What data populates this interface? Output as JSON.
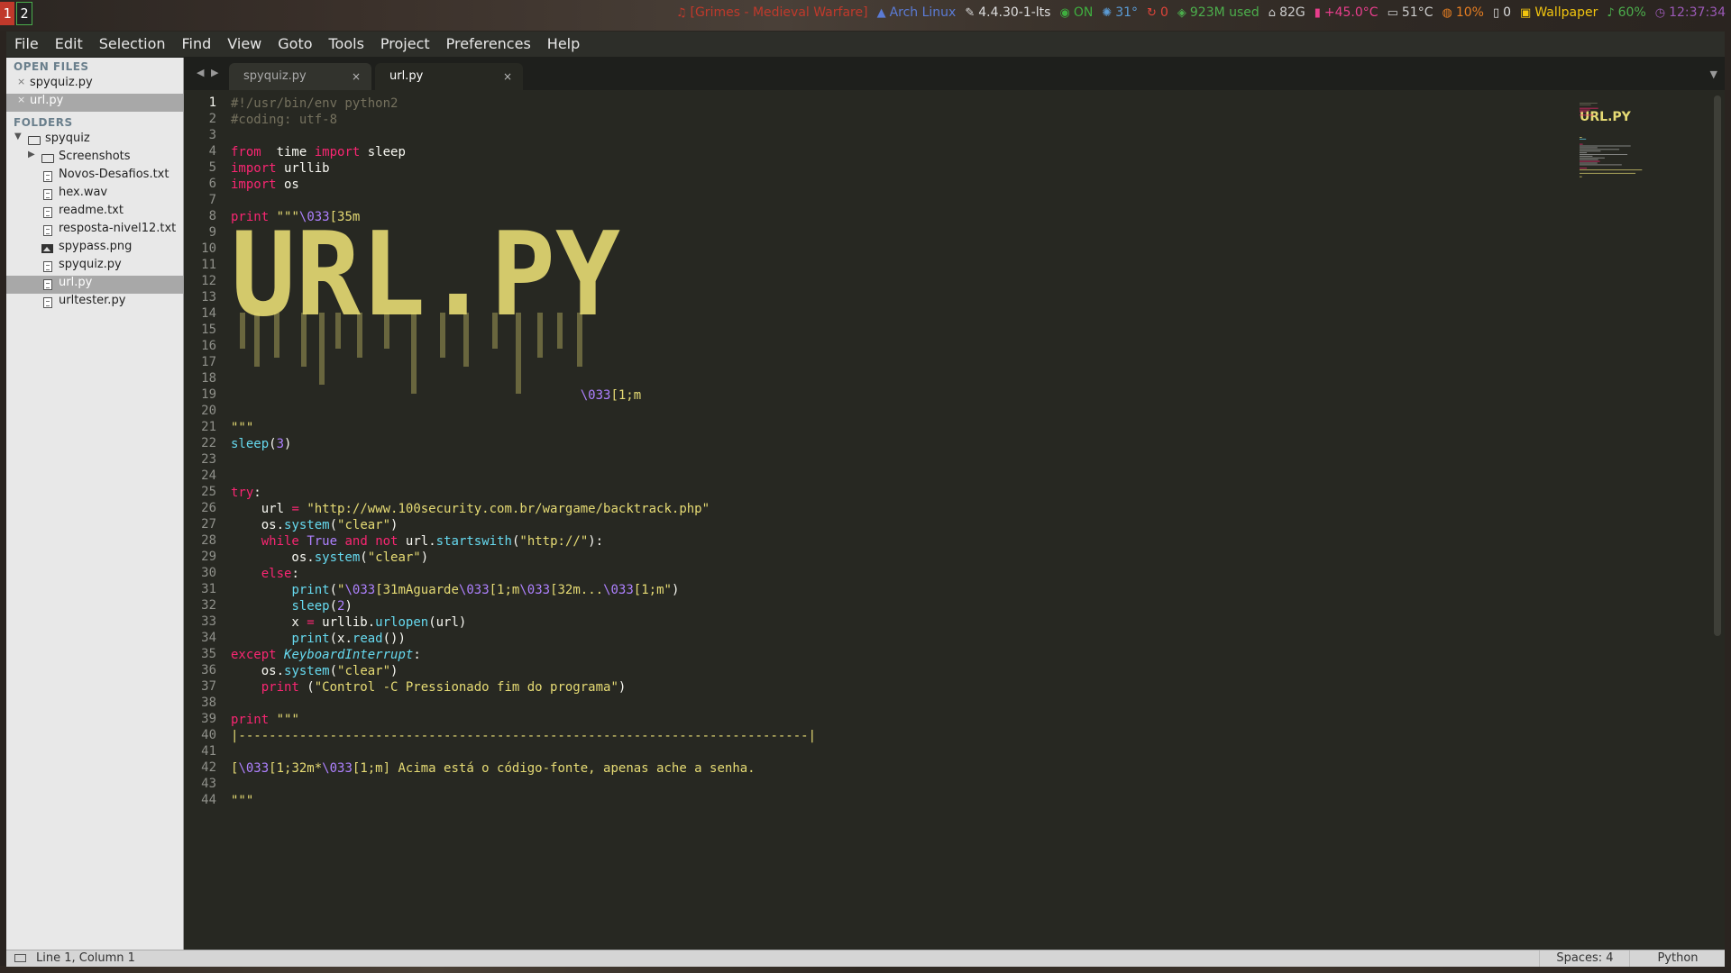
{
  "workspaces": [
    "1",
    "2"
  ],
  "statusbar_top": [
    {
      "icon": "music-icon",
      "text": "[Grimes - Medieval Warfare]",
      "color": "#c0392b"
    },
    {
      "icon": "arch-icon",
      "text": "Arch Linux",
      "color": "#5b7bd5"
    },
    {
      "icon": "wrench-icon",
      "text": "4.4.30-1-lts",
      "color": "#dddddd"
    },
    {
      "icon": "globe-icon",
      "text": "ON",
      "color": "#3fae3f"
    },
    {
      "icon": "gear-icon",
      "text": "31°",
      "color": "#5b9bd5"
    },
    {
      "icon": "refresh-icon",
      "text": "0",
      "color": "#e0443a"
    },
    {
      "icon": "memory-icon",
      "text": "923M used",
      "color": "#4cae4c"
    },
    {
      "icon": "home-icon",
      "text": "82G",
      "color": "#cccccc"
    },
    {
      "icon": "thermometer-icon",
      "text": "+45.0°C",
      "color": "#e83e8c"
    },
    {
      "icon": "monitor-icon",
      "text": "51°C",
      "color": "#cccccc"
    },
    {
      "icon": "cpu-icon",
      "text": "10%",
      "color": "#e67e22"
    },
    {
      "icon": "trash-icon",
      "text": "0",
      "color": "#dddddd"
    },
    {
      "icon": "image-icon",
      "text": "Wallpaper",
      "color": "#f1c40f"
    },
    {
      "icon": "volume-icon",
      "text": "60%",
      "color": "#4cae4c"
    },
    {
      "icon": "clock-icon",
      "text": "12:37:34",
      "color": "#9b59b6"
    }
  ],
  "menu": [
    "File",
    "Edit",
    "Selection",
    "Find",
    "View",
    "Goto",
    "Tools",
    "Project",
    "Preferences",
    "Help"
  ],
  "sidebar": {
    "open_files_header": "OPEN FILES",
    "open_files": [
      {
        "name": "spyquiz.py",
        "selected": false
      },
      {
        "name": "url.py",
        "selected": true
      }
    ],
    "folders_header": "FOLDERS",
    "root": "spyquiz",
    "tree": [
      {
        "name": "Screenshots",
        "type": "folder"
      },
      {
        "name": "Novos-Desafios.txt",
        "type": "file"
      },
      {
        "name": "hex.wav",
        "type": "file"
      },
      {
        "name": "readme.txt",
        "type": "file"
      },
      {
        "name": "resposta-nivel12.txt",
        "type": "file"
      },
      {
        "name": "spypass.png",
        "type": "image"
      },
      {
        "name": "spyquiz.py",
        "type": "file"
      },
      {
        "name": "url.py",
        "type": "file",
        "selected": true
      },
      {
        "name": "urltester.py",
        "type": "file"
      }
    ]
  },
  "tabs": [
    {
      "label": "spyquiz.py",
      "active": false
    },
    {
      "label": "url.py",
      "active": true
    }
  ],
  "code_lines": [
    [
      [
        "cm",
        "#!/usr/bin/env python2"
      ]
    ],
    [
      [
        "cm",
        "#coding: utf-8"
      ]
    ],
    [],
    [
      [
        "kw",
        "from"
      ],
      [
        "",
        "  time "
      ],
      [
        "kw",
        "import"
      ],
      [
        "",
        " sleep"
      ]
    ],
    [
      [
        "kw",
        "import"
      ],
      [
        "",
        " urllib"
      ]
    ],
    [
      [
        "kw",
        "import"
      ],
      [
        "",
        " os"
      ]
    ],
    [],
    [
      [
        "kw",
        "print"
      ],
      [
        "",
        " "
      ],
      [
        "st2",
        "\"\"\""
      ],
      [
        "nm",
        "\\033"
      ],
      [
        "st2",
        "[35m"
      ]
    ],
    [],
    [],
    [],
    [],
    [],
    [],
    [],
    [],
    [],
    [],
    [
      [
        "",
        "                                              "
      ],
      [
        "nm",
        "\\033"
      ],
      [
        "st2",
        "[1;m"
      ]
    ],
    [],
    [
      [
        "st2",
        "\"\"\""
      ]
    ],
    [
      [
        "fn",
        "sleep"
      ],
      [
        "",
        "("
      ],
      [
        "nm",
        "3"
      ],
      [
        "",
        ")"
      ]
    ],
    [],
    [],
    [
      [
        "kw",
        "try"
      ],
      [
        "",
        ":"
      ]
    ],
    [
      [
        "",
        "    url "
      ],
      [
        "kw",
        "="
      ],
      [
        "",
        " "
      ],
      [
        "st2",
        "\"http://www.100security.com.br/wargame/backtrack.php\""
      ]
    ],
    [
      [
        "",
        "    os."
      ],
      [
        "fn",
        "system"
      ],
      [
        "",
        "("
      ],
      [
        "st2",
        "\"clear\""
      ],
      [
        "",
        ")"
      ]
    ],
    [
      [
        "",
        "    "
      ],
      [
        "kw",
        "while"
      ],
      [
        "",
        " "
      ],
      [
        "nm",
        "True"
      ],
      [
        "",
        " "
      ],
      [
        "kw",
        "and"
      ],
      [
        "",
        " "
      ],
      [
        "kw",
        "not"
      ],
      [
        "",
        " url."
      ],
      [
        "fn",
        "startswith"
      ],
      [
        "",
        "("
      ],
      [
        "st2",
        "\"http://\""
      ],
      [
        "",
        "):"
      ]
    ],
    [
      [
        "",
        "        os."
      ],
      [
        "fn",
        "system"
      ],
      [
        "",
        "("
      ],
      [
        "st2",
        "\"clear\""
      ],
      [
        "",
        ")"
      ]
    ],
    [
      [
        "",
        "    "
      ],
      [
        "kw",
        "else"
      ],
      [
        "",
        ":"
      ]
    ],
    [
      [
        "",
        "        "
      ],
      [
        "fn",
        "print"
      ],
      [
        "",
        "("
      ],
      [
        "st2",
        "\""
      ],
      [
        "nm",
        "\\033"
      ],
      [
        "st2",
        "[31mAguarde"
      ],
      [
        "nm",
        "\\033"
      ],
      [
        "st2",
        "[1;m"
      ],
      [
        "nm",
        "\\033"
      ],
      [
        "st2",
        "[32m..."
      ],
      [
        "nm",
        "\\033"
      ],
      [
        "st2",
        "[1;m\""
      ],
      [
        "",
        ")"
      ]
    ],
    [
      [
        "",
        "        "
      ],
      [
        "fn",
        "sleep"
      ],
      [
        "",
        "("
      ],
      [
        "nm",
        "2"
      ],
      [
        "",
        ")"
      ]
    ],
    [
      [
        "",
        "        x "
      ],
      [
        "kw",
        "="
      ],
      [
        "",
        " urllib."
      ],
      [
        "fn",
        "urlopen"
      ],
      [
        "",
        "(url)"
      ]
    ],
    [
      [
        "",
        "        "
      ],
      [
        "fn",
        "print"
      ],
      [
        "",
        "(x."
      ],
      [
        "fn",
        "read"
      ],
      [
        "",
        "())"
      ]
    ],
    [
      [
        "kw",
        "except"
      ],
      [
        "",
        " "
      ],
      [
        "cls",
        "KeyboardInterrupt"
      ],
      [
        "",
        ":"
      ]
    ],
    [
      [
        "",
        "    os."
      ],
      [
        "fn",
        "system"
      ],
      [
        "",
        "("
      ],
      [
        "st2",
        "\"clear\""
      ],
      [
        "",
        ")"
      ]
    ],
    [
      [
        "",
        "    "
      ],
      [
        "kw",
        "print"
      ],
      [
        "",
        " ("
      ],
      [
        "st2",
        "\"Control -C Pressionado fim do programa\""
      ],
      [
        "",
        ")"
      ]
    ],
    [],
    [
      [
        "kw",
        "print"
      ],
      [
        "",
        " "
      ],
      [
        "st2",
        "\"\"\""
      ]
    ],
    [
      [
        "st2",
        "|---------------------------------------------------------------------------|"
      ]
    ],
    [],
    [
      [
        "st2",
        "["
      ],
      [
        "nm",
        "\\033"
      ],
      [
        "st2",
        "[1;32m*"
      ],
      [
        "nm",
        "\\033"
      ],
      [
        "st2",
        "[1;m] Acima está o código-fonte, apenas ache a senha."
      ]
    ],
    [],
    [
      [
        "st2",
        "\"\"\""
      ]
    ]
  ],
  "ascii_art_text": "URL.PY",
  "editor_status": {
    "position": "Line 1, Column 1",
    "spaces": "Spaces: 4",
    "syntax": "Python"
  },
  "colors": {
    "bg": "#272822",
    "keyword": "#f92672",
    "string": "#e6db74",
    "number": "#ae81ff",
    "function": "#66d9ef",
    "comment": "#75715e",
    "art": "#e6db74"
  }
}
